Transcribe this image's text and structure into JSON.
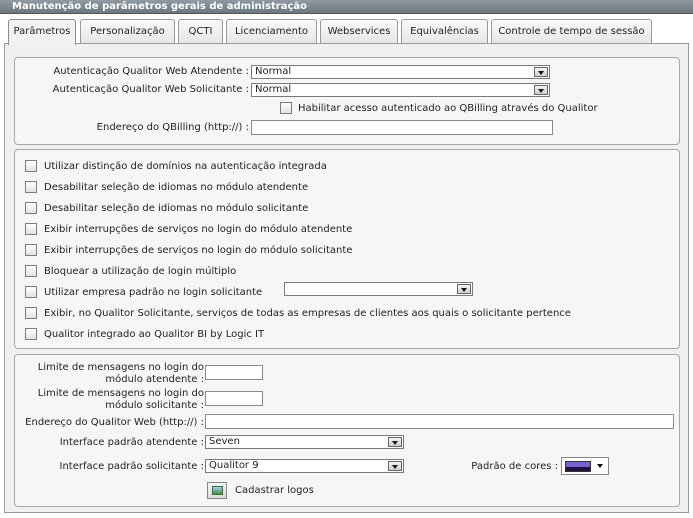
{
  "window": {
    "title": "Manutenção de parâmetros gerais de administração"
  },
  "tabs": [
    {
      "label": "Parâmetros",
      "active": true
    },
    {
      "label": "Personalização",
      "active": false
    },
    {
      "label": "QCTI",
      "active": false
    },
    {
      "label": "Licenciamento",
      "active": false
    },
    {
      "label": "Webservices",
      "active": false
    },
    {
      "label": "Equivalências",
      "active": false
    },
    {
      "label": "Controle de tempo de sessão",
      "active": false
    }
  ],
  "auth": {
    "atendente_label": "Autenticação Qualitor Web Atendente :",
    "atendente_value": "Normal",
    "solicitante_label": "Autenticação Qualitor Web Solicitante :",
    "solicitante_value": "Normal",
    "qbilling_checkbox": "Habilitar acesso autenticado ao QBilling através do Qualitor",
    "qbilling_address_label": "Endereço do QBilling (http://) :",
    "qbilling_address_value": ""
  },
  "options": [
    "Utilizar distinção de domínios na autenticação integrada",
    "Desabilitar seleção de idiomas no módulo atendente",
    "Desabilitar seleção de idiomas no módulo solicitante",
    "Exibir interrupções de serviços no login do módulo atendente",
    "Exibir interrupções de serviços no login do módulo solicitante",
    "Bloquear a utilização de login múltiplo",
    "Utilizar empresa padrão no login solicitante",
    "Exibir, no Qualitor Solicitante, serviços de todas as empresas de clientes aos quais o solicitante pertence",
    "Qualitor integrado ao Qualitor BI by Logic IT"
  ],
  "empresa_padrao_value": "",
  "login": {
    "limite_atendente_label_1": "Limite de mensagens no login do",
    "limite_atendente_label_2": "módulo atendente :",
    "limite_atendente_value": "",
    "limite_solicitante_label_1": "Limite de mensagens no login do",
    "limite_solicitante_label_2": "módulo solicitante :",
    "limite_solicitante_value": "",
    "web_address_label": "Endereço do Qualitor Web (http://) :",
    "web_address_value": "",
    "interface_atendente_label": "Interface padrão atendente :",
    "interface_atendente_value": "Seven",
    "interface_solicitante_label": "Interface padrão solicitante :",
    "interface_solicitante_value": "Qualitor 9",
    "cores_label": "Padrão de cores :",
    "cores_colors": [
      "#7a5fd0",
      "#1e1140"
    ],
    "logos_label": "Cadastrar logos"
  }
}
